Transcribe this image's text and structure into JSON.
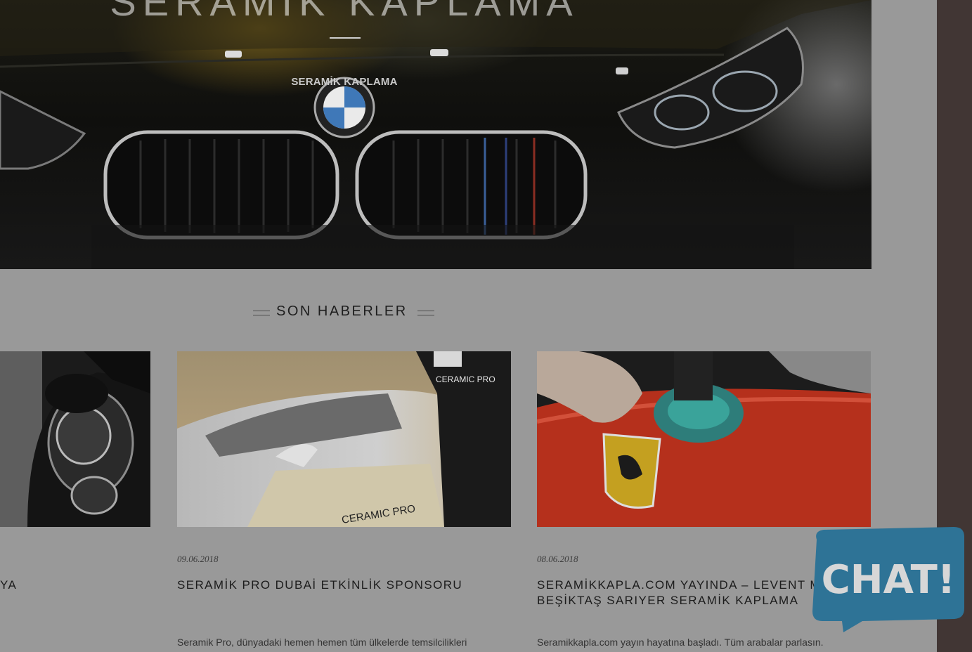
{
  "hero": {
    "title": "SERAMİK KAPLAMA",
    "subtitle": "SERAMİK KAPLAMA"
  },
  "news": {
    "heading": "SON HABERLER",
    "cards": [
      {
        "date": "",
        "title": "YA",
        "excerpt": ""
      },
      {
        "date": "09.06.2018",
        "title": "SERAMİK PRO DUBAİ ETKİNLİK SPONSORU",
        "excerpt": "Seramik Pro, dünyadaki hemen hemen tüm ülkelerde temsilcilikleri"
      },
      {
        "date": "08.06.2018",
        "title": "SERAMİKKAPLA.COM YAYINDA – LEVENT MASLAK BEŞİKTAŞ SARIYER SERAMİK KAPLAMA",
        "excerpt": "Seramikkapla.com yayın hayatına başladı. Tüm arabalar parlasın."
      }
    ]
  },
  "chat": {
    "label": "CHAT!",
    "color": "#2e7396"
  },
  "colors": {
    "overlay": "#999999",
    "sidebar": "#413634"
  },
  "icons": {
    "chat": "chat-bubble-icon"
  }
}
